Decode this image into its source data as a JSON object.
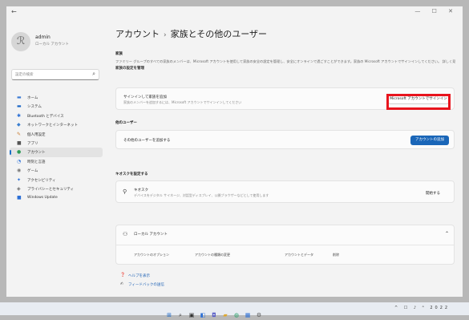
{
  "window": {
    "controls": "—  ☐  ✕"
  },
  "profile": {
    "avatar": "ℛ",
    "name": "admin",
    "subtitle": "ローカル アカウント"
  },
  "search": {
    "placeholder": "設定の検索"
  },
  "nav": [
    {
      "icon": "home-icon",
      "glyph": "▬",
      "color": "#3b7bd4",
      "label": "ホーム",
      "active": false
    },
    {
      "icon": "system-icon",
      "glyph": "▬",
      "color": "#1a66c6",
      "label": "システム",
      "active": false
    },
    {
      "icon": "bluetooth-icon",
      "glyph": "✱",
      "color": "#2b6fd6",
      "label": "Bluetooth とデバイス",
      "active": false
    },
    {
      "icon": "network-icon",
      "glyph": "◆",
      "color": "#3a7fd0",
      "label": "ネットワークとインターネット",
      "active": false
    },
    {
      "icon": "personalize-icon",
      "glyph": "✎",
      "color": "#c77a30",
      "label": "個人用設定",
      "active": false
    },
    {
      "icon": "apps-icon",
      "glyph": "■",
      "color": "#555",
      "label": "アプリ",
      "active": false
    },
    {
      "icon": "accounts-icon",
      "glyph": "●",
      "color": "#2f9a57",
      "label": "アカウント",
      "active": true
    },
    {
      "icon": "time-icon",
      "glyph": "◔",
      "color": "#2b6fd6",
      "label": "時刻と言語",
      "active": false
    },
    {
      "icon": "gaming-icon",
      "glyph": "◉",
      "color": "#777",
      "label": "ゲーム",
      "active": false
    },
    {
      "icon": "accessibility-icon",
      "glyph": "✦",
      "color": "#2b6fd6",
      "label": "アクセシビリティ",
      "active": false
    },
    {
      "icon": "privacy-icon",
      "glyph": "◈",
      "color": "#666",
      "label": "プライバシーとセキュリティ",
      "active": false
    },
    {
      "icon": "update-icon",
      "glyph": "■",
      "color": "#2b6fd6",
      "label": "Windows Update",
      "active": false
    }
  ],
  "main": {
    "breadcrumb_parent": "アカウント",
    "breadcrumb_sep": "›",
    "breadcrumb_current": "家族とその他のユーザー",
    "family_heading": "家族",
    "family_desc": "ファミリー グループのすべての家族のメンバーは、Microsoft アカウントを使用して家族の安全の設定を管理し、安全にオンラインで過ごすことができます。家族の Microsoft アカウントでサインインしてください。 詳しく見る",
    "family_link": "家族の設定を管理",
    "signin_card": {
      "title": "サインインして家族を追加",
      "desc": "家族のメンバーを追加するには、Microsoft アカウントでサインインしてください",
      "button": "Microsoft アカウントでサインイン"
    },
    "other_users_heading": "他のユーザー",
    "add_other_card": {
      "title": "その他のユーザーを追加する",
      "button": "アカウントの追加"
    },
    "kiosk_heading": "キオスクを設定する",
    "kiosk_card": {
      "title": "キオスク",
      "desc": "デバイスをデジタル サイネージ、対話型ディスプレイ、公開ブラウザーなどとして使用します",
      "button": "開始する"
    },
    "user_card": {
      "title": "ローカル アカウント",
      "account_options": "アカウントのオプション",
      "change_type": "アカウントの種類の変更",
      "remove_label": "アカウントとデータ",
      "remove_button": "削除"
    },
    "footer": [
      {
        "icon": "help-icon",
        "glyph": "❓",
        "label": "ヘルプを表示"
      },
      {
        "icon": "feedback-icon",
        "glyph": "✍",
        "label": "フィードバックの送信"
      }
    ]
  },
  "taskbar": {
    "icons": [
      {
        "icon": "start-icon",
        "glyph": "⊞",
        "color": "#1a66c6"
      },
      {
        "icon": "search-icon",
        "glyph": "⌕",
        "color": "#333"
      },
      {
        "icon": "taskview-icon",
        "glyph": "▣",
        "color": "#333"
      },
      {
        "icon": "widgets-icon",
        "glyph": "◧",
        "color": "#2b6fd6"
      },
      {
        "icon": "chat-icon",
        "glyph": "◘",
        "color": "#5b5fc7"
      },
      {
        "icon": "explorer-icon",
        "glyph": "▰",
        "color": "#e0a82e"
      },
      {
        "icon": "edge-icon",
        "glyph": "◍",
        "color": "#2aa36b"
      },
      {
        "icon": "store-icon",
        "glyph": "▦",
        "color": "#2b6fd6"
      },
      {
        "icon": "settings-icon",
        "glyph": "⚙",
        "color": "#555"
      }
    ],
    "tray_text": "^ ☐ ♪ ᴬ 2022"
  }
}
